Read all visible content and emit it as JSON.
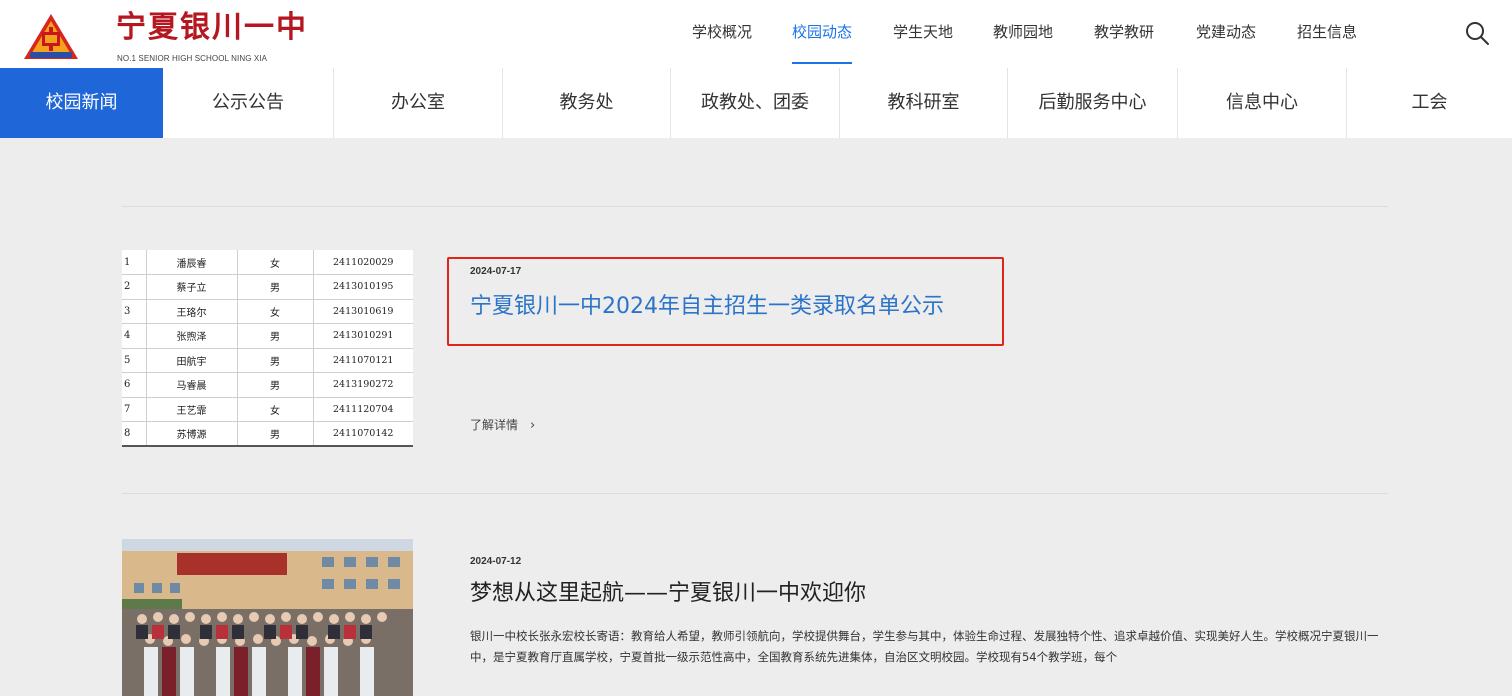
{
  "header": {
    "school_name": "宁夏银川一中",
    "school_name_en": "NO.1 SENIOR HIGH SCHOOL NING XIA",
    "nav": [
      {
        "label": "学校概况"
      },
      {
        "label": "校园动态"
      },
      {
        "label": "学生天地"
      },
      {
        "label": "教师园地"
      },
      {
        "label": "教学教研"
      },
      {
        "label": "党建动态"
      },
      {
        "label": "招生信息"
      }
    ],
    "active_nav": "校园动态",
    "search_icon": "search-icon"
  },
  "subnav": {
    "items": [
      {
        "label": "校园新闻"
      },
      {
        "label": "公示公告"
      },
      {
        "label": "办公室"
      },
      {
        "label": "教务处"
      },
      {
        "label": "政教处、团委"
      },
      {
        "label": "教科研室"
      },
      {
        "label": "后勤服务中心"
      },
      {
        "label": "信息中心"
      },
      {
        "label": "工会"
      }
    ],
    "active": "校园新闻"
  },
  "articles": [
    {
      "date": "2024-07-17",
      "title": "宁夏银川一中2024年自主招生一类录取名单公示",
      "more_label": "了解详情",
      "thumb_rows": [
        [
          "1",
          "潘辰睿",
          "女",
          "2411020029"
        ],
        [
          "2",
          "蔡子立",
          "男",
          "2413010195"
        ],
        [
          "3",
          "王珞尔",
          "女",
          "2413010619"
        ],
        [
          "4",
          "张煦泽",
          "男",
          "2413010291"
        ],
        [
          "5",
          "田航宇",
          "男",
          "2411070121"
        ],
        [
          "6",
          "马睿晨",
          "男",
          "2413190272"
        ],
        [
          "7",
          "王艺霏",
          "女",
          "2411120704"
        ],
        [
          "8",
          "苏博源",
          "男",
          "2411070142"
        ]
      ]
    },
    {
      "date": "2024-07-12",
      "title": "梦想从这里起航——宁夏银川一中欢迎你",
      "summary": "银川一中校长张永宏校长寄语：教育给人希望，教师引领航向，学校提供舞台，学生参与其中，体验生命过程、发展独特个性、追求卓越价值、实现美好人生。学校概况宁夏银川一中，是宁夏教育厅直属学校，宁夏首批一级示范性高中，全国教育系统先进集体，自治区文明校园。学校现有54个教学班，每个"
    }
  ],
  "colors": {
    "accent": "#1f66d8",
    "link": "#2b74c9",
    "brand": "#b5161f",
    "highlight": "#e2231a"
  }
}
